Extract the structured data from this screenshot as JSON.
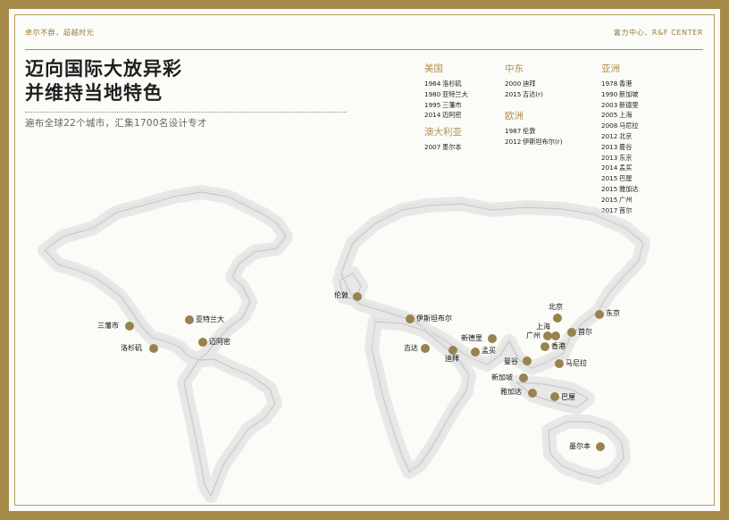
{
  "header": {
    "left": "卓尔不群，超越时光",
    "right": "富力中心、R&F CENTER"
  },
  "title": {
    "line1": "迈向国际大放异彩",
    "line2": "并维持当地特色"
  },
  "subtitle": "遍布全球22个城市，汇集1700名设计专才",
  "regions": {
    "usa": {
      "title": "美国",
      "entries": [
        {
          "year": "1964",
          "city": "洛杉矶"
        },
        {
          "year": "1980",
          "city": "亚特兰大"
        },
        {
          "year": "1995",
          "city": "三藩市"
        },
        {
          "year": "2014",
          "city": "迈阿密"
        }
      ]
    },
    "australia": {
      "title": "澳大利亚",
      "entries": [
        {
          "year": "2007",
          "city": "墨尔本"
        }
      ]
    },
    "middle_east": {
      "title": "中东",
      "entries": [
        {
          "year": "2000",
          "city": "迪拜"
        },
        {
          "year": "2015",
          "city": "吉达(r)"
        }
      ]
    },
    "europe": {
      "title": "欧洲",
      "entries": [
        {
          "year": "1987",
          "city": "伦敦"
        },
        {
          "year": "2012",
          "city": "伊斯坦布尔(r)"
        }
      ]
    },
    "asia": {
      "title": "亚洲",
      "entries": [
        {
          "year": "1978",
          "city": "香港"
        },
        {
          "year": "1990",
          "city": "新加坡"
        },
        {
          "year": "2003",
          "city": "新德里"
        },
        {
          "year": "2005",
          "city": "上海"
        },
        {
          "year": "2008",
          "city": "马尼拉"
        },
        {
          "year": "2012",
          "city": "北京"
        },
        {
          "year": "2013",
          "city": "曼谷"
        },
        {
          "year": "2013",
          "city": "东京"
        },
        {
          "year": "2014",
          "city": "孟买"
        },
        {
          "year": "2015",
          "city": "巴厘"
        },
        {
          "year": "2015",
          "city": "雅加达"
        },
        {
          "year": "2015",
          "city": "广州"
        },
        {
          "year": "2017",
          "city": "首尔"
        }
      ]
    }
  },
  "map": {
    "cities": {
      "sanfrancisco": "三藩市",
      "losangeles": "洛杉矶",
      "atlanta": "亚特兰大",
      "miami": "迈阿密",
      "london": "伦敦",
      "istanbul": "伊斯坦布尔",
      "jeddah": "吉达",
      "dubai": "迪拜",
      "newdelhi": "新德里",
      "mumbai": "孟买",
      "beijing": "北京",
      "tokyo": "东京",
      "shanghai": "上海",
      "guangzhou": "广州",
      "seoul": "首尔",
      "hongkong": "香港",
      "bangkok": "曼谷",
      "manila": "马尼拉",
      "singapore": "新加坡",
      "jakarta": "雅加达",
      "bali": "巴厘",
      "melbourne": "墨尔本"
    }
  },
  "colors": {
    "frame": "#a68a4a",
    "accent": "#b0904c",
    "dot": "#98834e"
  }
}
